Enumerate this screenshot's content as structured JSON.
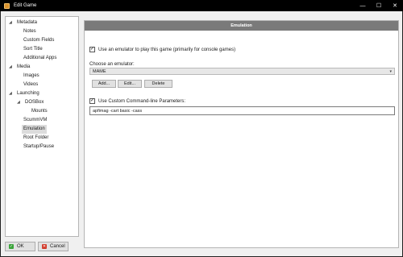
{
  "window": {
    "title": "Edit Game",
    "minimize_glyph": "—",
    "maximize_glyph": "☐",
    "close_glyph": "✕"
  },
  "tree": {
    "items": [
      {
        "label": "Metadata",
        "expanded": true
      },
      {
        "label": "Notes"
      },
      {
        "label": "Custom Fields"
      },
      {
        "label": "Sort Title"
      },
      {
        "label": "Additional Apps"
      },
      {
        "label": "Media",
        "expanded": true
      },
      {
        "label": "Images"
      },
      {
        "label": "Videos"
      },
      {
        "label": "Launching",
        "expanded": true
      },
      {
        "label": "DOSBox",
        "expanded": true
      },
      {
        "label": "Mounts"
      },
      {
        "label": "ScummVM"
      },
      {
        "label": "Emulation",
        "selected": true
      },
      {
        "label": "Root Folder"
      },
      {
        "label": "Startup/Pause"
      }
    ]
  },
  "panel": {
    "header": "Emulation",
    "use_emulator_label": "Use an emulator to play this game (primarily for console games)",
    "use_emulator_checked": true,
    "choose_label": "Choose an emulator:",
    "emulator_selected": "MAME",
    "add_label": "Add...",
    "edit_label": "Edit...",
    "delete_label": "Delete",
    "custom_cmd_label": "Use Custom Command-line Parameters:",
    "custom_cmd_checked": true,
    "custom_cmd_value": "apfimag -cart basic -cass"
  },
  "footer": {
    "ok_label": "OK",
    "cancel_label": "Cancel"
  },
  "icons": {
    "check_glyph": "✓",
    "cross_glyph": "✕",
    "expanded_arrow": "◢",
    "dropdown_chevron": "▾"
  }
}
